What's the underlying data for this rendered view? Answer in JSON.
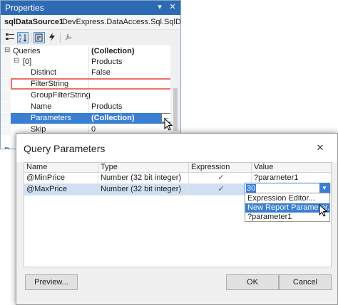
{
  "properties": {
    "title": "Properties",
    "window_buttons": {
      "pin": "▾",
      "close": "✕"
    },
    "object_name": "sqlDataSource1",
    "object_type": "DevExpress.DataAccess.Sql.SqlDataSou",
    "toolbar": [
      "categorized-icon",
      "alphabetical-icon",
      "properties-icon",
      "events-icon",
      "property-pages-icon"
    ],
    "rows": [
      {
        "expander": "⊟",
        "name": "Queries",
        "value": "(Collection)",
        "value_bold": true
      },
      {
        "expander": "⊟",
        "name": "[0]",
        "value": "Products"
      },
      {
        "name": "Distinct",
        "value": "False"
      },
      {
        "name": "FilterString",
        "value": ""
      },
      {
        "name": "GroupFilterString",
        "value": ""
      },
      {
        "name": "Name",
        "value": "Products"
      },
      {
        "name": "Parameters",
        "value": "(Collection)",
        "selected": true,
        "value_bold": true
      },
      {
        "name": "Skip",
        "value": "0"
      }
    ],
    "cutoff_label": "R",
    "ellipsis": "..."
  },
  "dialog": {
    "title": "Query Parameters",
    "close": "✕",
    "columns": [
      "Name",
      "Type",
      "Expression",
      "Value"
    ],
    "rows": [
      {
        "name": "@MinPrice",
        "type": "Number (32 bit integer)",
        "expression": true,
        "value": "?parameter1"
      },
      {
        "name": "@MaxPrice",
        "type": "Number (32 bit integer)",
        "expression": true,
        "value": "30",
        "selected": true
      }
    ],
    "dropdown_items": [
      "Expression Editor...",
      "New Report Parameter...",
      "?parameter1"
    ],
    "dropdown_highlight": 1,
    "buttons": {
      "preview": "Preview...",
      "ok": "OK",
      "cancel": "Cancel"
    }
  },
  "colors": {
    "accent": "#3a7fd1",
    "title_bar": "#2d6ab3",
    "highlight_border": "#e8736b"
  }
}
